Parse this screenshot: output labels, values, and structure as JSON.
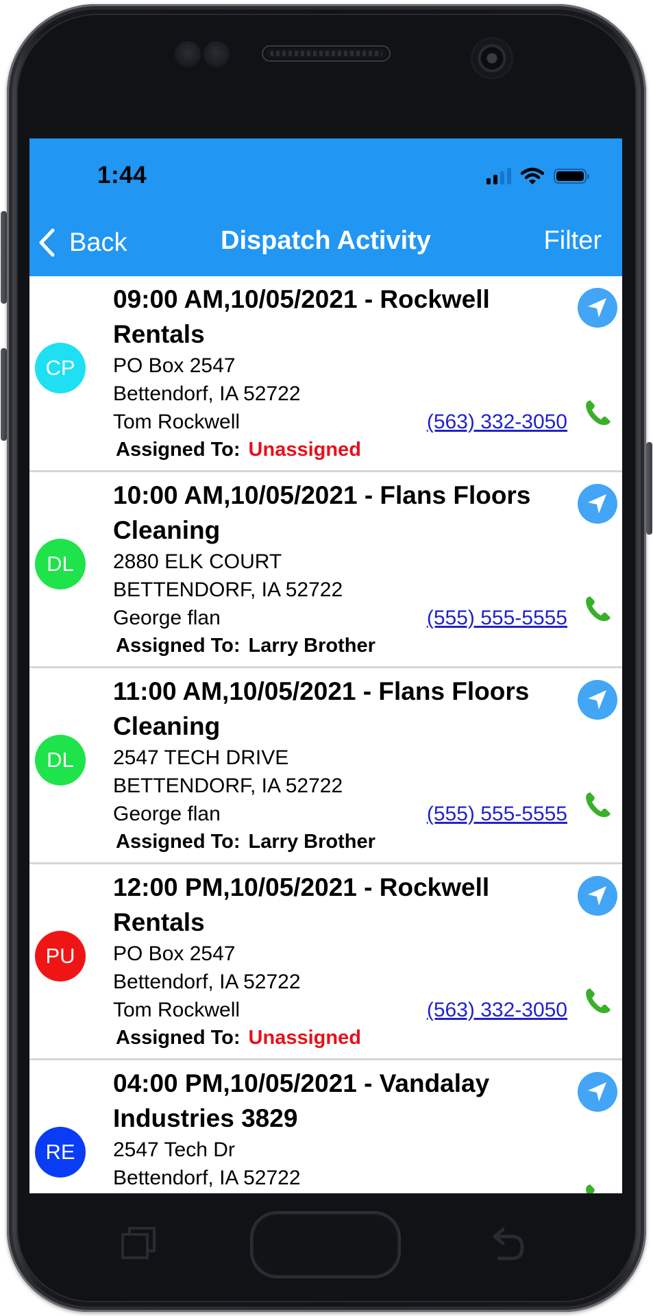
{
  "status_bar": {
    "time": "1:44",
    "signal_bars_active": 2,
    "signal_bars_total": 4,
    "wifi_icon": "wifi-icon",
    "battery_icon": "battery-icon"
  },
  "nav_bar": {
    "back_label": "Back",
    "title": "Dispatch Activity",
    "filter_label": "Filter",
    "background_color": "#2196f3"
  },
  "assigned_label": "Assigned To:",
  "colors": {
    "unassigned": "#e8101a",
    "phone_link": "#2222cc",
    "nav_button": "#42a5f5",
    "call_icon": "#3ab02a"
  },
  "activities": [
    {
      "initials": "CP",
      "avatar_color": "#1fe0f2",
      "title": "09:00 AM,10/05/2021 - Rockwell Rentals",
      "address_line1": "PO Box 2547",
      "address_line2": "Bettendorf, IA  52722",
      "contact": "Tom Rockwell",
      "phone": "(563) 332-3050",
      "assigned_to": "Unassigned",
      "is_unassigned": true
    },
    {
      "initials": "DL",
      "avatar_color": "#1ee34a",
      "title": "10:00 AM,10/05/2021 - Flans Floors Cleaning",
      "address_line1": "2880 ELK COURT",
      "address_line2": "BETTENDORF, IA  52722",
      "contact": "George flan",
      "phone": "(555) 555-5555",
      "assigned_to": "Larry Brother",
      "is_unassigned": false
    },
    {
      "initials": "DL",
      "avatar_color": "#1ee34a",
      "title": "11:00 AM,10/05/2021 - Flans Floors Cleaning",
      "address_line1": "2547 TECH DRIVE",
      "address_line2": "BETTENDORF, IA  52722",
      "contact": "George flan",
      "phone": "(555) 555-5555",
      "assigned_to": "Larry Brother",
      "is_unassigned": false
    },
    {
      "initials": "PU",
      "avatar_color": "#f01515",
      "title": "12:00 PM,10/05/2021 - Rockwell Rentals",
      "address_line1": "PO Box 2547",
      "address_line2": "Bettendorf, IA  52722",
      "contact": "Tom Rockwell",
      "phone": "(563) 332-3050",
      "assigned_to": "Unassigned",
      "is_unassigned": true
    },
    {
      "initials": "RE",
      "avatar_color": "#0a3cf5",
      "title": "04:00 PM,10/05/2021 - Vandalay Industries 3829",
      "address_line1": "2547 Tech Dr",
      "address_line2": "Bettendorf, IA  52722",
      "contact": "",
      "phone": "",
      "assigned_to": "",
      "is_unassigned": false
    }
  ]
}
